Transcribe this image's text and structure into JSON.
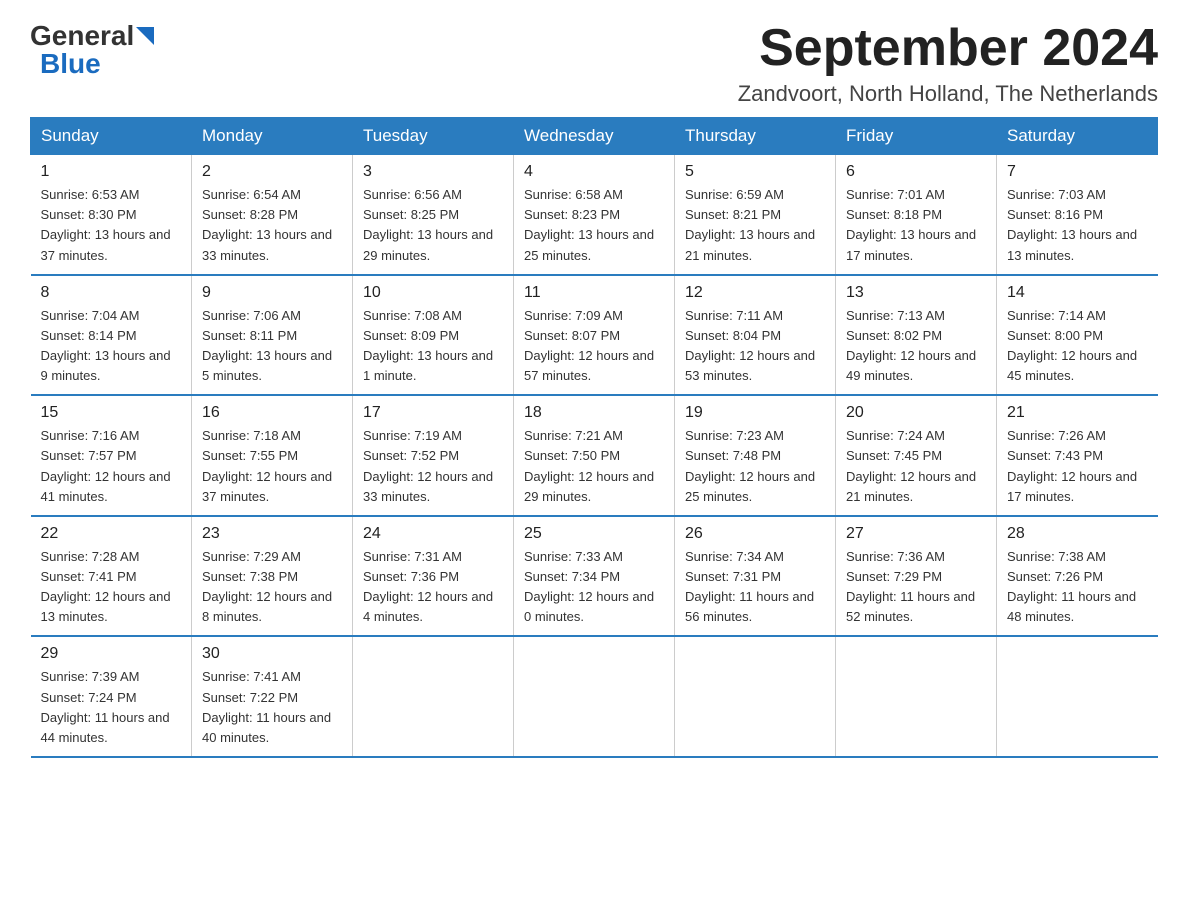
{
  "header": {
    "logo_general": "General",
    "logo_blue": "Blue",
    "month_title": "September 2024",
    "location": "Zandvoort, North Holland, The Netherlands"
  },
  "weekdays": [
    "Sunday",
    "Monday",
    "Tuesday",
    "Wednesday",
    "Thursday",
    "Friday",
    "Saturday"
  ],
  "weeks": [
    [
      {
        "day": "1",
        "sunrise": "6:53 AM",
        "sunset": "8:30 PM",
        "daylight": "13 hours and 37 minutes."
      },
      {
        "day": "2",
        "sunrise": "6:54 AM",
        "sunset": "8:28 PM",
        "daylight": "13 hours and 33 minutes."
      },
      {
        "day": "3",
        "sunrise": "6:56 AM",
        "sunset": "8:25 PM",
        "daylight": "13 hours and 29 minutes."
      },
      {
        "day": "4",
        "sunrise": "6:58 AM",
        "sunset": "8:23 PM",
        "daylight": "13 hours and 25 minutes."
      },
      {
        "day": "5",
        "sunrise": "6:59 AM",
        "sunset": "8:21 PM",
        "daylight": "13 hours and 21 minutes."
      },
      {
        "day": "6",
        "sunrise": "7:01 AM",
        "sunset": "8:18 PM",
        "daylight": "13 hours and 17 minutes."
      },
      {
        "day": "7",
        "sunrise": "7:03 AM",
        "sunset": "8:16 PM",
        "daylight": "13 hours and 13 minutes."
      }
    ],
    [
      {
        "day": "8",
        "sunrise": "7:04 AM",
        "sunset": "8:14 PM",
        "daylight": "13 hours and 9 minutes."
      },
      {
        "day": "9",
        "sunrise": "7:06 AM",
        "sunset": "8:11 PM",
        "daylight": "13 hours and 5 minutes."
      },
      {
        "day": "10",
        "sunrise": "7:08 AM",
        "sunset": "8:09 PM",
        "daylight": "13 hours and 1 minute."
      },
      {
        "day": "11",
        "sunrise": "7:09 AM",
        "sunset": "8:07 PM",
        "daylight": "12 hours and 57 minutes."
      },
      {
        "day": "12",
        "sunrise": "7:11 AM",
        "sunset": "8:04 PM",
        "daylight": "12 hours and 53 minutes."
      },
      {
        "day": "13",
        "sunrise": "7:13 AM",
        "sunset": "8:02 PM",
        "daylight": "12 hours and 49 minutes."
      },
      {
        "day": "14",
        "sunrise": "7:14 AM",
        "sunset": "8:00 PM",
        "daylight": "12 hours and 45 minutes."
      }
    ],
    [
      {
        "day": "15",
        "sunrise": "7:16 AM",
        "sunset": "7:57 PM",
        "daylight": "12 hours and 41 minutes."
      },
      {
        "day": "16",
        "sunrise": "7:18 AM",
        "sunset": "7:55 PM",
        "daylight": "12 hours and 37 minutes."
      },
      {
        "day": "17",
        "sunrise": "7:19 AM",
        "sunset": "7:52 PM",
        "daylight": "12 hours and 33 minutes."
      },
      {
        "day": "18",
        "sunrise": "7:21 AM",
        "sunset": "7:50 PM",
        "daylight": "12 hours and 29 minutes."
      },
      {
        "day": "19",
        "sunrise": "7:23 AM",
        "sunset": "7:48 PM",
        "daylight": "12 hours and 25 minutes."
      },
      {
        "day": "20",
        "sunrise": "7:24 AM",
        "sunset": "7:45 PM",
        "daylight": "12 hours and 21 minutes."
      },
      {
        "day": "21",
        "sunrise": "7:26 AM",
        "sunset": "7:43 PM",
        "daylight": "12 hours and 17 minutes."
      }
    ],
    [
      {
        "day": "22",
        "sunrise": "7:28 AM",
        "sunset": "7:41 PM",
        "daylight": "12 hours and 13 minutes."
      },
      {
        "day": "23",
        "sunrise": "7:29 AM",
        "sunset": "7:38 PM",
        "daylight": "12 hours and 8 minutes."
      },
      {
        "day": "24",
        "sunrise": "7:31 AM",
        "sunset": "7:36 PM",
        "daylight": "12 hours and 4 minutes."
      },
      {
        "day": "25",
        "sunrise": "7:33 AM",
        "sunset": "7:34 PM",
        "daylight": "12 hours and 0 minutes."
      },
      {
        "day": "26",
        "sunrise": "7:34 AM",
        "sunset": "7:31 PM",
        "daylight": "11 hours and 56 minutes."
      },
      {
        "day": "27",
        "sunrise": "7:36 AM",
        "sunset": "7:29 PM",
        "daylight": "11 hours and 52 minutes."
      },
      {
        "day": "28",
        "sunrise": "7:38 AM",
        "sunset": "7:26 PM",
        "daylight": "11 hours and 48 minutes."
      }
    ],
    [
      {
        "day": "29",
        "sunrise": "7:39 AM",
        "sunset": "7:24 PM",
        "daylight": "11 hours and 44 minutes."
      },
      {
        "day": "30",
        "sunrise": "7:41 AM",
        "sunset": "7:22 PM",
        "daylight": "11 hours and 40 minutes."
      },
      null,
      null,
      null,
      null,
      null
    ]
  ]
}
